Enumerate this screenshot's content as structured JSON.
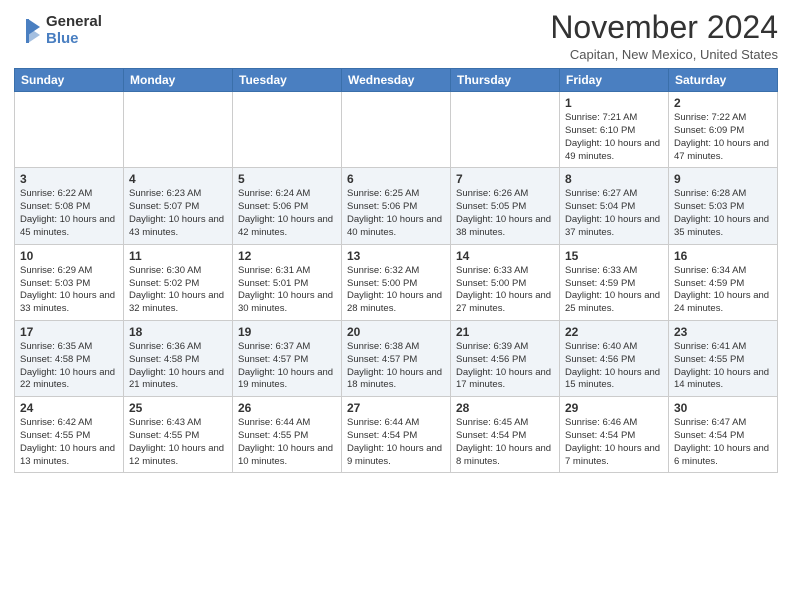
{
  "header": {
    "logo_general": "General",
    "logo_blue": "Blue",
    "month": "November 2024",
    "location": "Capitan, New Mexico, United States"
  },
  "days_of_week": [
    "Sunday",
    "Monday",
    "Tuesday",
    "Wednesday",
    "Thursday",
    "Friday",
    "Saturday"
  ],
  "weeks": [
    [
      {
        "day": "",
        "info": ""
      },
      {
        "day": "",
        "info": ""
      },
      {
        "day": "",
        "info": ""
      },
      {
        "day": "",
        "info": ""
      },
      {
        "day": "",
        "info": ""
      },
      {
        "day": "1",
        "info": "Sunrise: 7:21 AM\nSunset: 6:10 PM\nDaylight: 10 hours\nand 49 minutes."
      },
      {
        "day": "2",
        "info": "Sunrise: 7:22 AM\nSunset: 6:09 PM\nDaylight: 10 hours\nand 47 minutes."
      }
    ],
    [
      {
        "day": "3",
        "info": "Sunrise: 6:22 AM\nSunset: 5:08 PM\nDaylight: 10 hours\nand 45 minutes."
      },
      {
        "day": "4",
        "info": "Sunrise: 6:23 AM\nSunset: 5:07 PM\nDaylight: 10 hours\nand 43 minutes."
      },
      {
        "day": "5",
        "info": "Sunrise: 6:24 AM\nSunset: 5:06 PM\nDaylight: 10 hours\nand 42 minutes."
      },
      {
        "day": "6",
        "info": "Sunrise: 6:25 AM\nSunset: 5:06 PM\nDaylight: 10 hours\nand 40 minutes."
      },
      {
        "day": "7",
        "info": "Sunrise: 6:26 AM\nSunset: 5:05 PM\nDaylight: 10 hours\nand 38 minutes."
      },
      {
        "day": "8",
        "info": "Sunrise: 6:27 AM\nSunset: 5:04 PM\nDaylight: 10 hours\nand 37 minutes."
      },
      {
        "day": "9",
        "info": "Sunrise: 6:28 AM\nSunset: 5:03 PM\nDaylight: 10 hours\nand 35 minutes."
      }
    ],
    [
      {
        "day": "10",
        "info": "Sunrise: 6:29 AM\nSunset: 5:03 PM\nDaylight: 10 hours\nand 33 minutes."
      },
      {
        "day": "11",
        "info": "Sunrise: 6:30 AM\nSunset: 5:02 PM\nDaylight: 10 hours\nand 32 minutes."
      },
      {
        "day": "12",
        "info": "Sunrise: 6:31 AM\nSunset: 5:01 PM\nDaylight: 10 hours\nand 30 minutes."
      },
      {
        "day": "13",
        "info": "Sunrise: 6:32 AM\nSunset: 5:00 PM\nDaylight: 10 hours\nand 28 minutes."
      },
      {
        "day": "14",
        "info": "Sunrise: 6:33 AM\nSunset: 5:00 PM\nDaylight: 10 hours\nand 27 minutes."
      },
      {
        "day": "15",
        "info": "Sunrise: 6:33 AM\nSunset: 4:59 PM\nDaylight: 10 hours\nand 25 minutes."
      },
      {
        "day": "16",
        "info": "Sunrise: 6:34 AM\nSunset: 4:59 PM\nDaylight: 10 hours\nand 24 minutes."
      }
    ],
    [
      {
        "day": "17",
        "info": "Sunrise: 6:35 AM\nSunset: 4:58 PM\nDaylight: 10 hours\nand 22 minutes."
      },
      {
        "day": "18",
        "info": "Sunrise: 6:36 AM\nSunset: 4:58 PM\nDaylight: 10 hours\nand 21 minutes."
      },
      {
        "day": "19",
        "info": "Sunrise: 6:37 AM\nSunset: 4:57 PM\nDaylight: 10 hours\nand 19 minutes."
      },
      {
        "day": "20",
        "info": "Sunrise: 6:38 AM\nSunset: 4:57 PM\nDaylight: 10 hours\nand 18 minutes."
      },
      {
        "day": "21",
        "info": "Sunrise: 6:39 AM\nSunset: 4:56 PM\nDaylight: 10 hours\nand 17 minutes."
      },
      {
        "day": "22",
        "info": "Sunrise: 6:40 AM\nSunset: 4:56 PM\nDaylight: 10 hours\nand 15 minutes."
      },
      {
        "day": "23",
        "info": "Sunrise: 6:41 AM\nSunset: 4:55 PM\nDaylight: 10 hours\nand 14 minutes."
      }
    ],
    [
      {
        "day": "24",
        "info": "Sunrise: 6:42 AM\nSunset: 4:55 PM\nDaylight: 10 hours\nand 13 minutes."
      },
      {
        "day": "25",
        "info": "Sunrise: 6:43 AM\nSunset: 4:55 PM\nDaylight: 10 hours\nand 12 minutes."
      },
      {
        "day": "26",
        "info": "Sunrise: 6:44 AM\nSunset: 4:55 PM\nDaylight: 10 hours\nand 10 minutes."
      },
      {
        "day": "27",
        "info": "Sunrise: 6:44 AM\nSunset: 4:54 PM\nDaylight: 10 hours\nand 9 minutes."
      },
      {
        "day": "28",
        "info": "Sunrise: 6:45 AM\nSunset: 4:54 PM\nDaylight: 10 hours\nand 8 minutes."
      },
      {
        "day": "29",
        "info": "Sunrise: 6:46 AM\nSunset: 4:54 PM\nDaylight: 10 hours\nand 7 minutes."
      },
      {
        "day": "30",
        "info": "Sunrise: 6:47 AM\nSunset: 4:54 PM\nDaylight: 10 hours\nand 6 minutes."
      }
    ]
  ]
}
